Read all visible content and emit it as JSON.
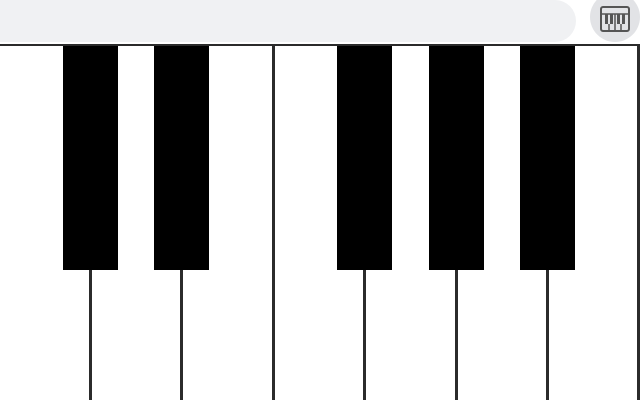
{
  "topbar": {
    "search_placeholder": "",
    "keyboard_icon": "piano-keyboard-icon"
  },
  "piano": {
    "white_keys": 7,
    "black_key_after_white": [
      0,
      1,
      3,
      4,
      5
    ],
    "colors": {
      "white_key": "#ffffff",
      "black_key": "#000000",
      "key_border": "#2b2b2b"
    }
  }
}
